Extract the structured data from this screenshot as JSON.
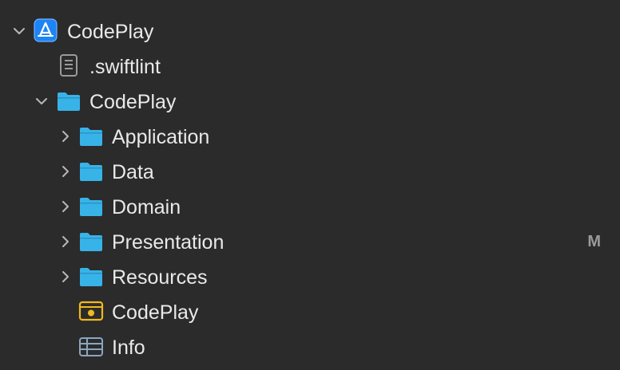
{
  "navigator": {
    "items": [
      {
        "label": "CodePlay",
        "icon": "xcode-project-icon",
        "expanded": true
      },
      {
        "label": ".swiftlint",
        "icon": "document-icon"
      },
      {
        "label": "CodePlay",
        "icon": "folder-icon",
        "expanded": true
      },
      {
        "label": "Application",
        "icon": "folder-icon",
        "expanded": false
      },
      {
        "label": "Data",
        "icon": "folder-icon",
        "expanded": false
      },
      {
        "label": "Domain",
        "icon": "folder-icon",
        "expanded": false
      },
      {
        "label": "Presentation",
        "icon": "folder-icon",
        "expanded": false,
        "status": "M"
      },
      {
        "label": "Resources",
        "icon": "folder-icon",
        "expanded": false
      },
      {
        "label": "CodePlay",
        "icon": "asset-catalog-icon"
      },
      {
        "label": "Info",
        "icon": "plist-icon"
      }
    ]
  },
  "colors": {
    "background": "#2b2b2c",
    "text": "#e9e9ea",
    "folder": "#38b3e8",
    "project": "#1d84f5",
    "asset": "#f2b81d",
    "status": "#9a9a9c"
  }
}
